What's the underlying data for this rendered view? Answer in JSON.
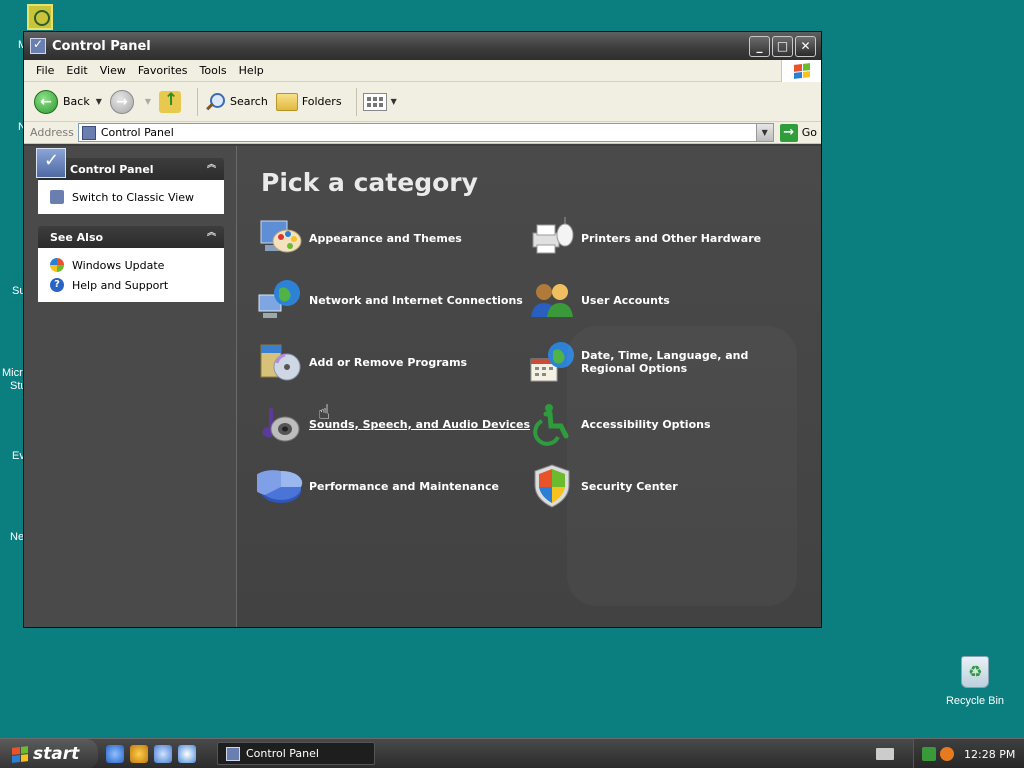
{
  "desktop": {
    "partial_labels": [
      "M",
      "N",
      "Su",
      "Micro",
      "Stu",
      "Ev",
      "Ne"
    ],
    "recycle_bin_label": "Recycle Bin"
  },
  "window": {
    "title": "Control Panel",
    "menu": [
      "File",
      "Edit",
      "View",
      "Favorites",
      "Tools",
      "Help"
    ],
    "toolbar": {
      "back_label": "Back",
      "search_label": "Search",
      "folders_label": "Folders"
    },
    "address": {
      "label": "Address",
      "value": "Control Panel",
      "go_label": "Go"
    }
  },
  "sidebar": {
    "control_panel": {
      "title": "Control Panel",
      "items": [
        {
          "label": "Switch to Classic View",
          "icon": "switch-view-icon"
        }
      ]
    },
    "see_also": {
      "title": "See Also",
      "items": [
        {
          "label": "Windows Update",
          "icon": "windows-update-icon"
        },
        {
          "label": "Help and Support",
          "icon": "help-icon"
        }
      ]
    }
  },
  "main": {
    "heading": "Pick a category",
    "categories_left": [
      {
        "label": "Appearance and Themes",
        "icon": "appearance-themes-icon"
      },
      {
        "label": "Network and Internet Connections",
        "icon": "network-icon"
      },
      {
        "label": "Add or Remove Programs",
        "icon": "add-remove-programs-icon"
      },
      {
        "label": "Sounds, Speech, and Audio Devices",
        "icon": "sounds-audio-icon"
      },
      {
        "label": "Performance and Maintenance",
        "icon": "performance-icon"
      }
    ],
    "categories_right": [
      {
        "label": "Printers and Other Hardware",
        "icon": "printer-icon"
      },
      {
        "label": "User Accounts",
        "icon": "user-accounts-icon"
      },
      {
        "label": "Date, Time, Language, and Regional Options",
        "icon": "date-time-icon"
      },
      {
        "label": "Accessibility Options",
        "icon": "accessibility-icon"
      },
      {
        "label": "Security Center",
        "icon": "security-shield-icon"
      }
    ]
  },
  "taskbar": {
    "start_label": "start",
    "task_label": "Control Panel",
    "clock": "12:28 PM"
  },
  "colors": {
    "desktop": "#0b7f7f",
    "window_body": "#444444",
    "accent_green": "#2f9e3a"
  }
}
